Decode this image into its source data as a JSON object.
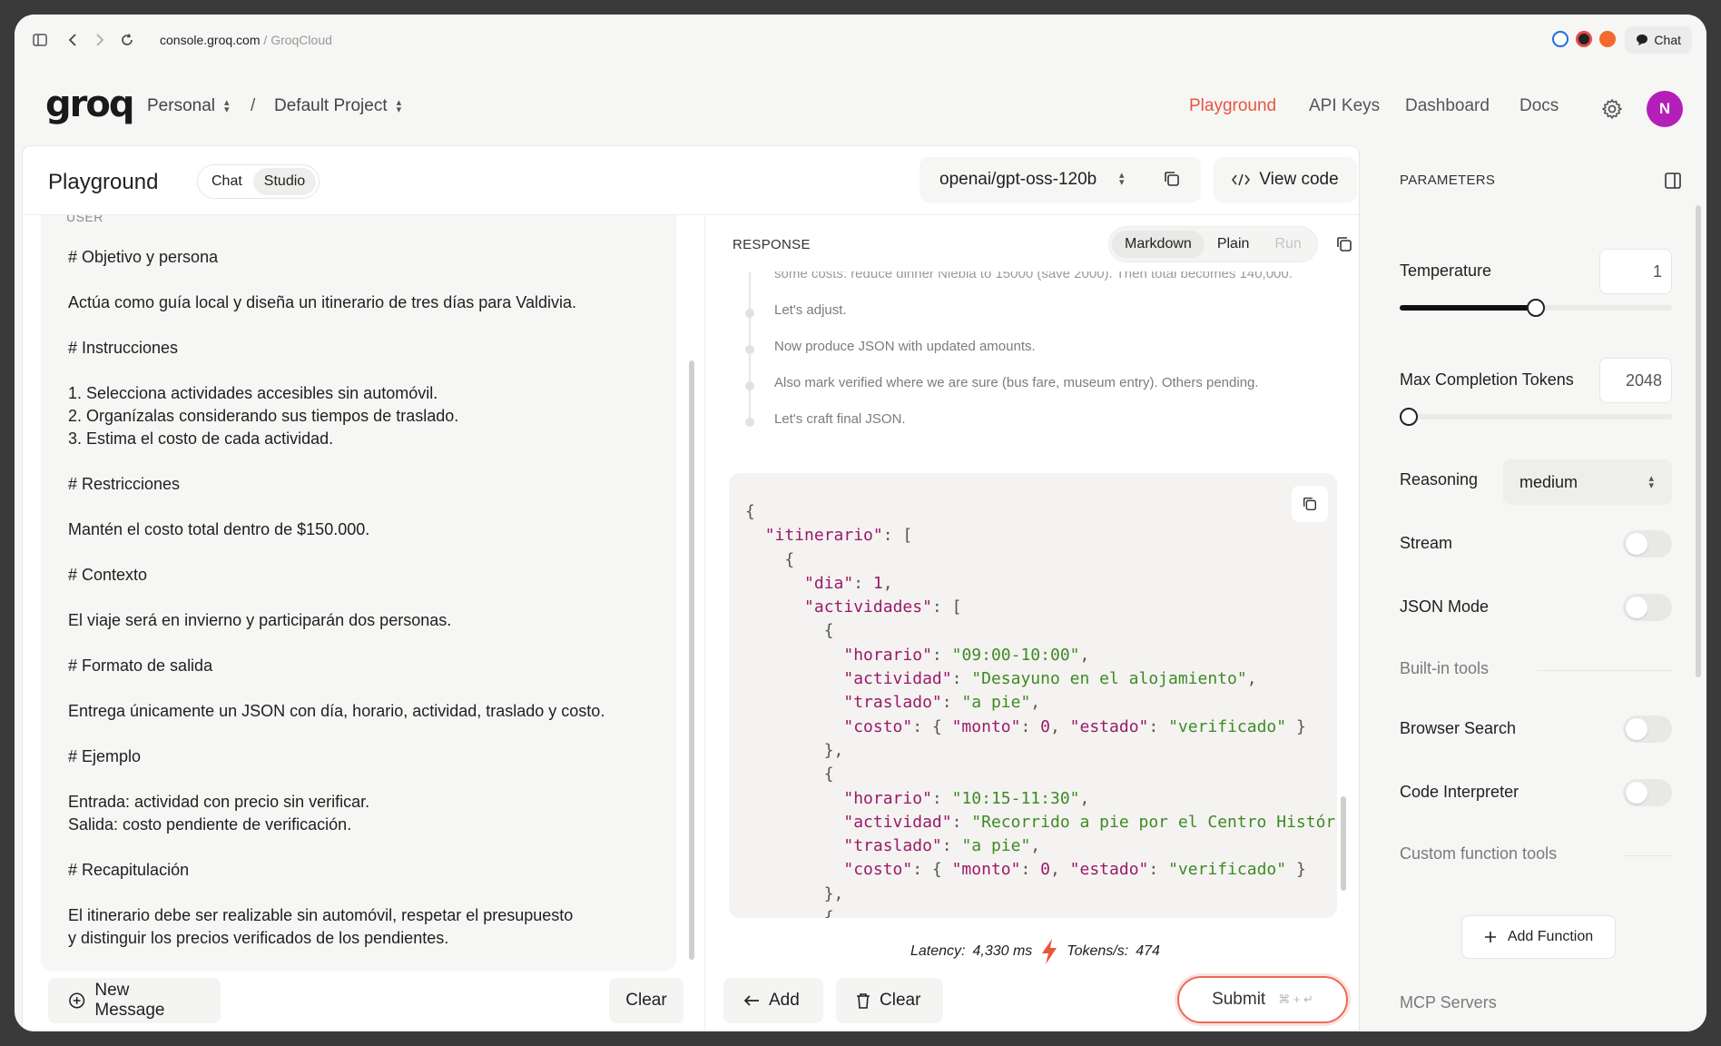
{
  "browser": {
    "url_host": "console.groq.com",
    "url_path": "GroqCloud",
    "chat_label": "Chat"
  },
  "header": {
    "logo": "groq",
    "workspace": "Personal",
    "separator": "/",
    "project": "Default Project",
    "nav": [
      "Playground",
      "API Keys",
      "Dashboard",
      "Docs"
    ],
    "avatar_initial": "N"
  },
  "toolbar": {
    "title": "Playground",
    "modes": [
      "Chat",
      "Studio"
    ],
    "model": "openai/gpt-oss-120b",
    "view_code": "View code"
  },
  "user_message": {
    "role_label": "USER",
    "paragraphs": [
      "# Objetivo y persona",
      "Actúa como guía local y diseña un itinerario de tres días para Valdivia.",
      "# Instrucciones",
      "1. Selecciona actividades accesibles sin automóvil.\n2. Organízalas considerando sus tiempos de traslado.\n3. Estima el costo de cada actividad.",
      "# Restricciones",
      "Mantén el costo total dentro de $150.000.",
      "# Contexto",
      "El viaje será en invierno y participarán dos personas.",
      "# Formato de salida",
      "Entrega únicamente un JSON con día, horario, actividad, traslado y costo.",
      "# Ejemplo",
      "Entrada: actividad con precio sin verificar.\nSalida: costo pendiente de verificación.",
      "# Recapitulación",
      "El itinerario debe ser realizable sin automóvil, respetar el presupuesto\ny distinguir los precios verificados de los pendientes."
    ]
  },
  "left_actions": {
    "new_message": "New Message",
    "clear": "Clear"
  },
  "response": {
    "label": "RESPONSE",
    "formats": [
      "Markdown",
      "Plain",
      "Run"
    ],
    "cut_line": "some costs: reduce dinner Niebla to 15000 (save 2000). Then total becomes 140,000.",
    "thinking": [
      "Let's adjust.",
      "Now produce JSON with updated amounts.",
      "Also mark verified where we are sure (bus fare, museum entry). Others pending.",
      "Let's craft final JSON."
    ],
    "json": {
      "key_itinerario": "\"itinerario\"",
      "key_dia": "\"dia\"",
      "dia_value": "1",
      "key_actividades": "\"actividades\"",
      "key_horario": "\"horario\"",
      "key_actividad": "\"actividad\"",
      "key_traslado": "\"traslado\"",
      "key_costo": "\"costo\"",
      "key_monto": "\"monto\"",
      "key_estado": "\"estado\"",
      "items": [
        {
          "horario": "\"09:00-10:00\"",
          "actividad": "\"Desayuno en el alojamiento\"",
          "actividad_suffix": ",",
          "traslado": "\"a pie\"",
          "monto": "0",
          "estado": "\"verificado\""
        },
        {
          "horario": "\"10:15-11:30\"",
          "actividad": "\"Recorrido a pie por el Centro Históric",
          "actividad_suffix": "",
          "traslado": "\"a pie\"",
          "monto": "0",
          "estado": "\"verificado\""
        }
      ]
    },
    "latency_label": "Latency:",
    "latency_value": "4,330 ms",
    "tokens_label": "Tokens/s:",
    "tokens_value": "474"
  },
  "right_actions": {
    "add": "Add",
    "clear": "Clear",
    "submit": "Submit",
    "submit_shortcut": "⌘ + ↵"
  },
  "parameters": {
    "header": "PARAMETERS",
    "temperature_label": "Temperature",
    "temperature_value": "1",
    "temperature_fraction": 0.5,
    "max_tokens_label": "Max Completion Tokens",
    "max_tokens_value": "2048",
    "max_tokens_fraction": 0.02,
    "reasoning_label": "Reasoning",
    "reasoning_value": "medium",
    "stream_label": "Stream",
    "json_mode_label": "JSON Mode",
    "builtin_tools_label": "Built-in tools",
    "browser_search_label": "Browser Search",
    "code_interpreter_label": "Code Interpreter",
    "custom_tools_label": "Custom function tools",
    "add_function": "Add Function",
    "mcp_servers_label": "MCP Servers"
  },
  "colors": {
    "accent": "#e8553e",
    "avatar": "#b31fb8",
    "json_key": "#9a1a6a",
    "json_string": "#3f8a24"
  }
}
